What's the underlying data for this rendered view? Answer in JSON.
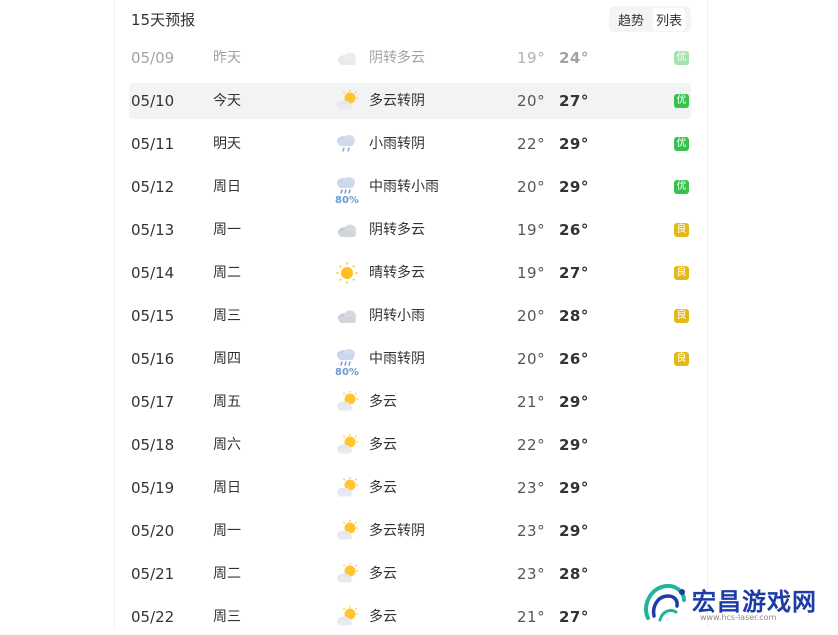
{
  "header": {
    "title": "15天预报",
    "tabs": [
      "趋势",
      "列表"
    ],
    "active_tab": "列表"
  },
  "days": [
    {
      "date": "05/09",
      "week": "昨天",
      "icon": "cloudy-icon",
      "desc": "阴转多云",
      "low": "19°",
      "high": "24°",
      "aqi": "优",
      "aqi_level": "good",
      "state": "past"
    },
    {
      "date": "05/10",
      "week": "今天",
      "icon": "partly-cloudy-icon",
      "desc": "多云转阴",
      "low": "20°",
      "high": "27°",
      "aqi": "优",
      "aqi_level": "good",
      "state": "today"
    },
    {
      "date": "05/11",
      "week": "明天",
      "icon": "light-rain-icon",
      "desc": "小雨转阴",
      "low": "22°",
      "high": "29°",
      "aqi": "优",
      "aqi_level": "good",
      "state": ""
    },
    {
      "date": "05/12",
      "week": "周日",
      "icon": "moderate-rain-icon",
      "pop": "80%",
      "desc": "中雨转小雨",
      "low": "20°",
      "high": "29°",
      "aqi": "优",
      "aqi_level": "good",
      "state": ""
    },
    {
      "date": "05/13",
      "week": "周一",
      "icon": "cloudy-icon",
      "desc": "阴转多云",
      "low": "19°",
      "high": "26°",
      "aqi": "良",
      "aqi_level": "ok",
      "state": ""
    },
    {
      "date": "05/14",
      "week": "周二",
      "icon": "sunny-icon",
      "desc": "晴转多云",
      "low": "19°",
      "high": "27°",
      "aqi": "良",
      "aqi_level": "ok",
      "state": ""
    },
    {
      "date": "05/15",
      "week": "周三",
      "icon": "cloudy-icon",
      "desc": "阴转小雨",
      "low": "20°",
      "high": "28°",
      "aqi": "良",
      "aqi_level": "ok",
      "state": ""
    },
    {
      "date": "05/16",
      "week": "周四",
      "icon": "moderate-rain-icon",
      "pop": "80%",
      "desc": "中雨转阴",
      "low": "20°",
      "high": "26°",
      "aqi": "良",
      "aqi_level": "ok",
      "state": ""
    },
    {
      "date": "05/17",
      "week": "周五",
      "icon": "partly-cloudy-icon",
      "desc": "多云",
      "low": "21°",
      "high": "29°",
      "aqi": "",
      "aqi_level": "",
      "state": ""
    },
    {
      "date": "05/18",
      "week": "周六",
      "icon": "partly-cloudy-icon",
      "desc": "多云",
      "low": "22°",
      "high": "29°",
      "aqi": "",
      "aqi_level": "",
      "state": ""
    },
    {
      "date": "05/19",
      "week": "周日",
      "icon": "partly-cloudy-icon",
      "desc": "多云",
      "low": "23°",
      "high": "29°",
      "aqi": "",
      "aqi_level": "",
      "state": ""
    },
    {
      "date": "05/20",
      "week": "周一",
      "icon": "partly-cloudy-icon",
      "desc": "多云转阴",
      "low": "23°",
      "high": "29°",
      "aqi": "",
      "aqi_level": "",
      "state": ""
    },
    {
      "date": "05/21",
      "week": "周二",
      "icon": "partly-cloudy-icon",
      "desc": "多云",
      "low": "23°",
      "high": "28°",
      "aqi": "",
      "aqi_level": "",
      "state": ""
    },
    {
      "date": "05/22",
      "week": "周三",
      "icon": "partly-cloudy-icon",
      "desc": "多云",
      "low": "21°",
      "high": "27°",
      "aqi": "",
      "aqi_level": "",
      "state": ""
    }
  ],
  "colors": {
    "aqi_good": "#37c34b",
    "aqi_ok": "#e5b819",
    "rain_text": "#6a9ad4",
    "watermark": "#1d3ca8"
  },
  "watermark": {
    "title": "宏昌游戏网",
    "url": "www.hcs-laser.com"
  }
}
